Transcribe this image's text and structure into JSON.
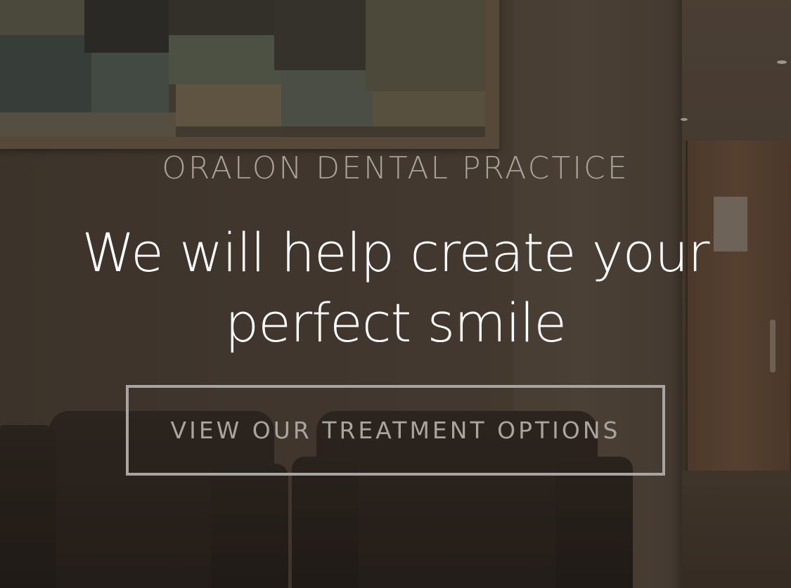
{
  "hero": {
    "practice_name": "ORALON DENTAL PRACTICE",
    "headline_line1": "We will help create your",
    "headline_line2": "perfect smile",
    "cta_label": "VIEW OUR TREATMENT OPTIONS"
  },
  "colors": {
    "practice_name": "#a9a29b",
    "headline": "#ffffff",
    "cta_border": "#a8a4a1",
    "cta_text": "#aaa49e",
    "background_tone": "#3b322b"
  }
}
